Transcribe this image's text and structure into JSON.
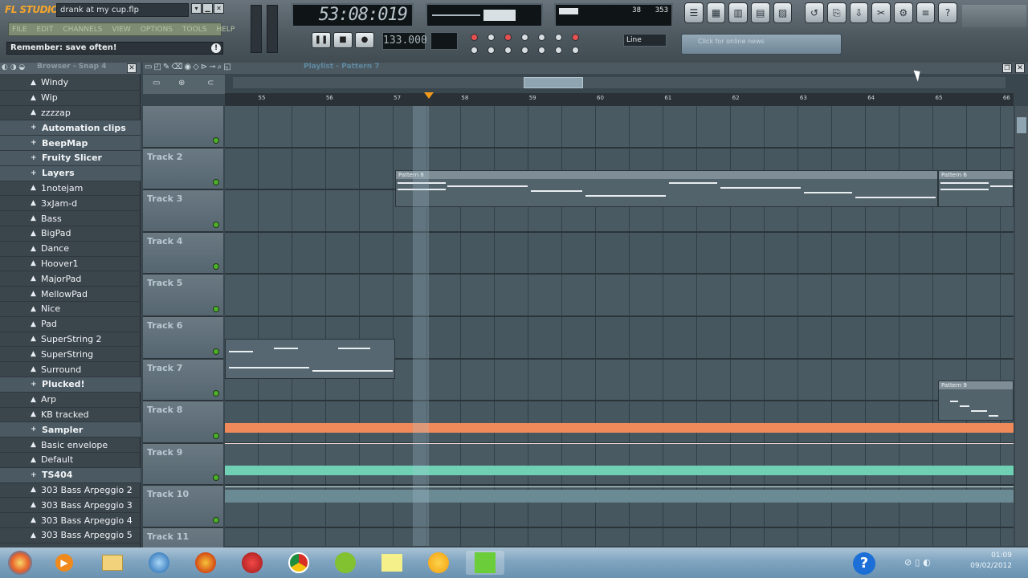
{
  "app": {
    "brand": "FL STUDIO",
    "filename": "drank at my cup.flp",
    "hint": "Remember: save often!",
    "menu": [
      "FILE",
      "EDIT",
      "CHANNELS",
      "VIEW",
      "OPTIONS",
      "TOOLS",
      "HELP"
    ],
    "time_display": "53:08:019",
    "tempo": "133.000",
    "cpu": "38",
    "poly": "353",
    "snap": "Line",
    "news": "Click for online news",
    "accent": "#f39a1d"
  },
  "browser": {
    "title": "Browser - Snap 4",
    "items": [
      {
        "label": "Windy",
        "type": "file"
      },
      {
        "label": "Wip",
        "type": "file"
      },
      {
        "label": "zzzzap",
        "type": "file"
      },
      {
        "label": "Automation clips",
        "type": "folder"
      },
      {
        "label": "BeepMap",
        "type": "folder"
      },
      {
        "label": "Fruity Slicer",
        "type": "folder"
      },
      {
        "label": "Layers",
        "type": "folder"
      },
      {
        "label": "1notejam",
        "type": "file"
      },
      {
        "label": "3xJam-d",
        "type": "file"
      },
      {
        "label": "Bass",
        "type": "file"
      },
      {
        "label": "BigPad",
        "type": "file"
      },
      {
        "label": "Dance",
        "type": "file"
      },
      {
        "label": "Hoover1",
        "type": "file"
      },
      {
        "label": "MajorPad",
        "type": "file"
      },
      {
        "label": "MellowPad",
        "type": "file"
      },
      {
        "label": "Nice",
        "type": "file"
      },
      {
        "label": "Pad",
        "type": "file"
      },
      {
        "label": "SuperString 2",
        "type": "file"
      },
      {
        "label": "SuperString",
        "type": "file"
      },
      {
        "label": "Surround",
        "type": "file"
      },
      {
        "label": "Plucked!",
        "type": "folder"
      },
      {
        "label": "Arp",
        "type": "file"
      },
      {
        "label": "KB tracked",
        "type": "file"
      },
      {
        "label": "Sampler",
        "type": "folder"
      },
      {
        "label": "Basic envelope",
        "type": "file"
      },
      {
        "label": "Default",
        "type": "file"
      },
      {
        "label": "TS404",
        "type": "folder"
      },
      {
        "label": "303 Bass Arpeggio 2",
        "type": "file"
      },
      {
        "label": "303 Bass Arpeggio 3",
        "type": "file"
      },
      {
        "label": "303 Bass Arpeggio 4",
        "type": "file"
      },
      {
        "label": "303 Bass Arpeggio 5",
        "type": "file"
      }
    ]
  },
  "playlist": {
    "title": "Playlist - Pattern 7",
    "bars": [
      "55",
      "56",
      "57",
      "58",
      "59",
      "60",
      "61",
      "62",
      "63",
      "64",
      "65",
      "66"
    ],
    "tracks": [
      "",
      "Track 2",
      "Track 3",
      "Track 4",
      "Track 5",
      "Track 6",
      "Track 7",
      "Track 8",
      "Track 9",
      "Track 10",
      "Track 11"
    ],
    "clips": [
      {
        "label": "Pattern 8"
      },
      {
        "label": "Pattern 6"
      },
      {
        "label": "Pattern 9"
      }
    ],
    "auto_colors": [
      "#f08a5a",
      "#6fd0b4"
    ]
  },
  "taskbar": {
    "time": "01:09",
    "date": "09/02/2012"
  }
}
